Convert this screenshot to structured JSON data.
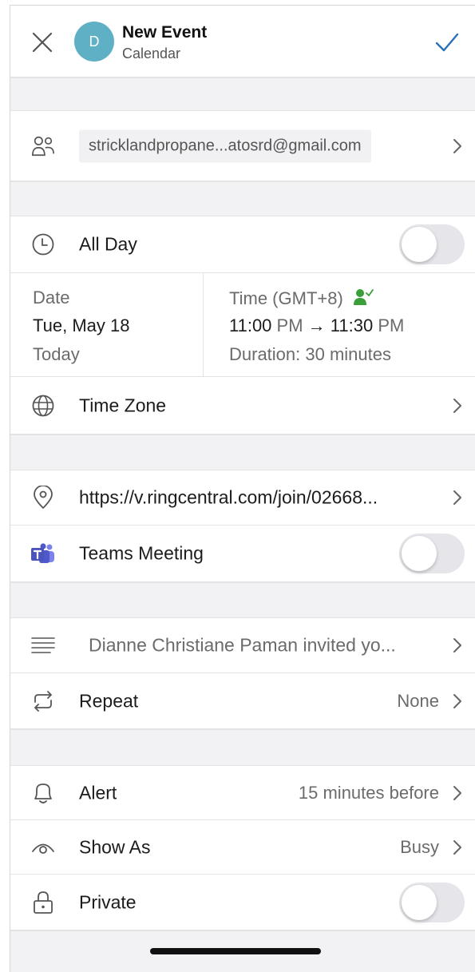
{
  "header": {
    "avatar_initial": "D",
    "title": "New Event",
    "subtitle": "Calendar"
  },
  "attendees": {
    "email": "stricklandpropane...atosrd@gmail.com"
  },
  "all_day": {
    "label": "All Day",
    "on": false
  },
  "date": {
    "label": "Date",
    "value": "Tue, May 18",
    "relative": "Today"
  },
  "time": {
    "label": "Time (GMT+8)",
    "start_time": "11:00",
    "start_period": "PM",
    "arrow": "→",
    "end_time": "11:30",
    "end_period": "PM",
    "duration": "Duration: 30 minutes"
  },
  "time_zone": {
    "label": "Time Zone"
  },
  "location": {
    "value": "https://v.ringcentral.com/join/02668..."
  },
  "teams_meeting": {
    "label": "Teams Meeting",
    "on": false
  },
  "description": {
    "value": "Dianne Christiane Paman invited yo..."
  },
  "repeat": {
    "label": "Repeat",
    "value": "None"
  },
  "alert": {
    "label": "Alert",
    "value": "15 minutes before"
  },
  "show_as": {
    "label": "Show As",
    "value": "Busy"
  },
  "private": {
    "label": "Private",
    "on": false
  },
  "colors": {
    "accent": "#2b6fb6",
    "avatar": "#5fb0c4",
    "teams": "#4b53bc",
    "available": "#3a9e3a"
  }
}
